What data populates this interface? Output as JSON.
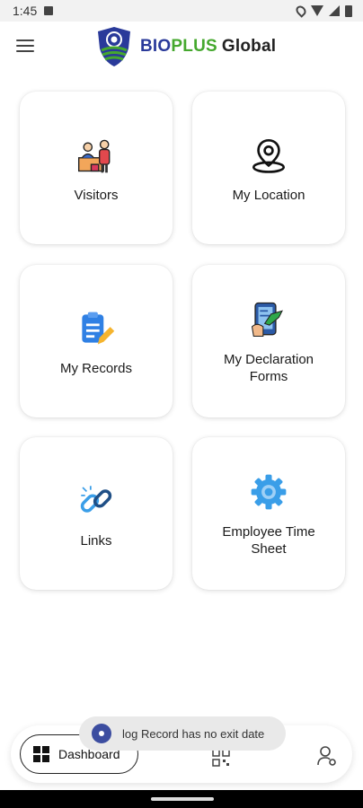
{
  "status_bar": {
    "time": "1:45"
  },
  "header": {
    "brand_part1": "BIO",
    "brand_part2": "PLUS",
    "brand_part3": "Global"
  },
  "cards": [
    {
      "label": "Visitors",
      "icon": "visitors-icon"
    },
    {
      "label": "My Location",
      "icon": "location-pin-icon"
    },
    {
      "label": "My Records",
      "icon": "clipboard-edit-icon"
    },
    {
      "label": "My Declaration Forms",
      "icon": "tablet-form-icon"
    },
    {
      "label": "Links",
      "icon": "link-chain-icon"
    },
    {
      "label": "Employee Time Sheet",
      "icon": "gear-icon"
    }
  ],
  "toast": {
    "message": "log Record has no exit date"
  },
  "bottom_nav": {
    "dashboard_label": "Dashboard"
  },
  "colors": {
    "brand_blue": "#2a3a9a",
    "brand_green": "#45a82e",
    "gear_blue": "#3a9ee8"
  }
}
